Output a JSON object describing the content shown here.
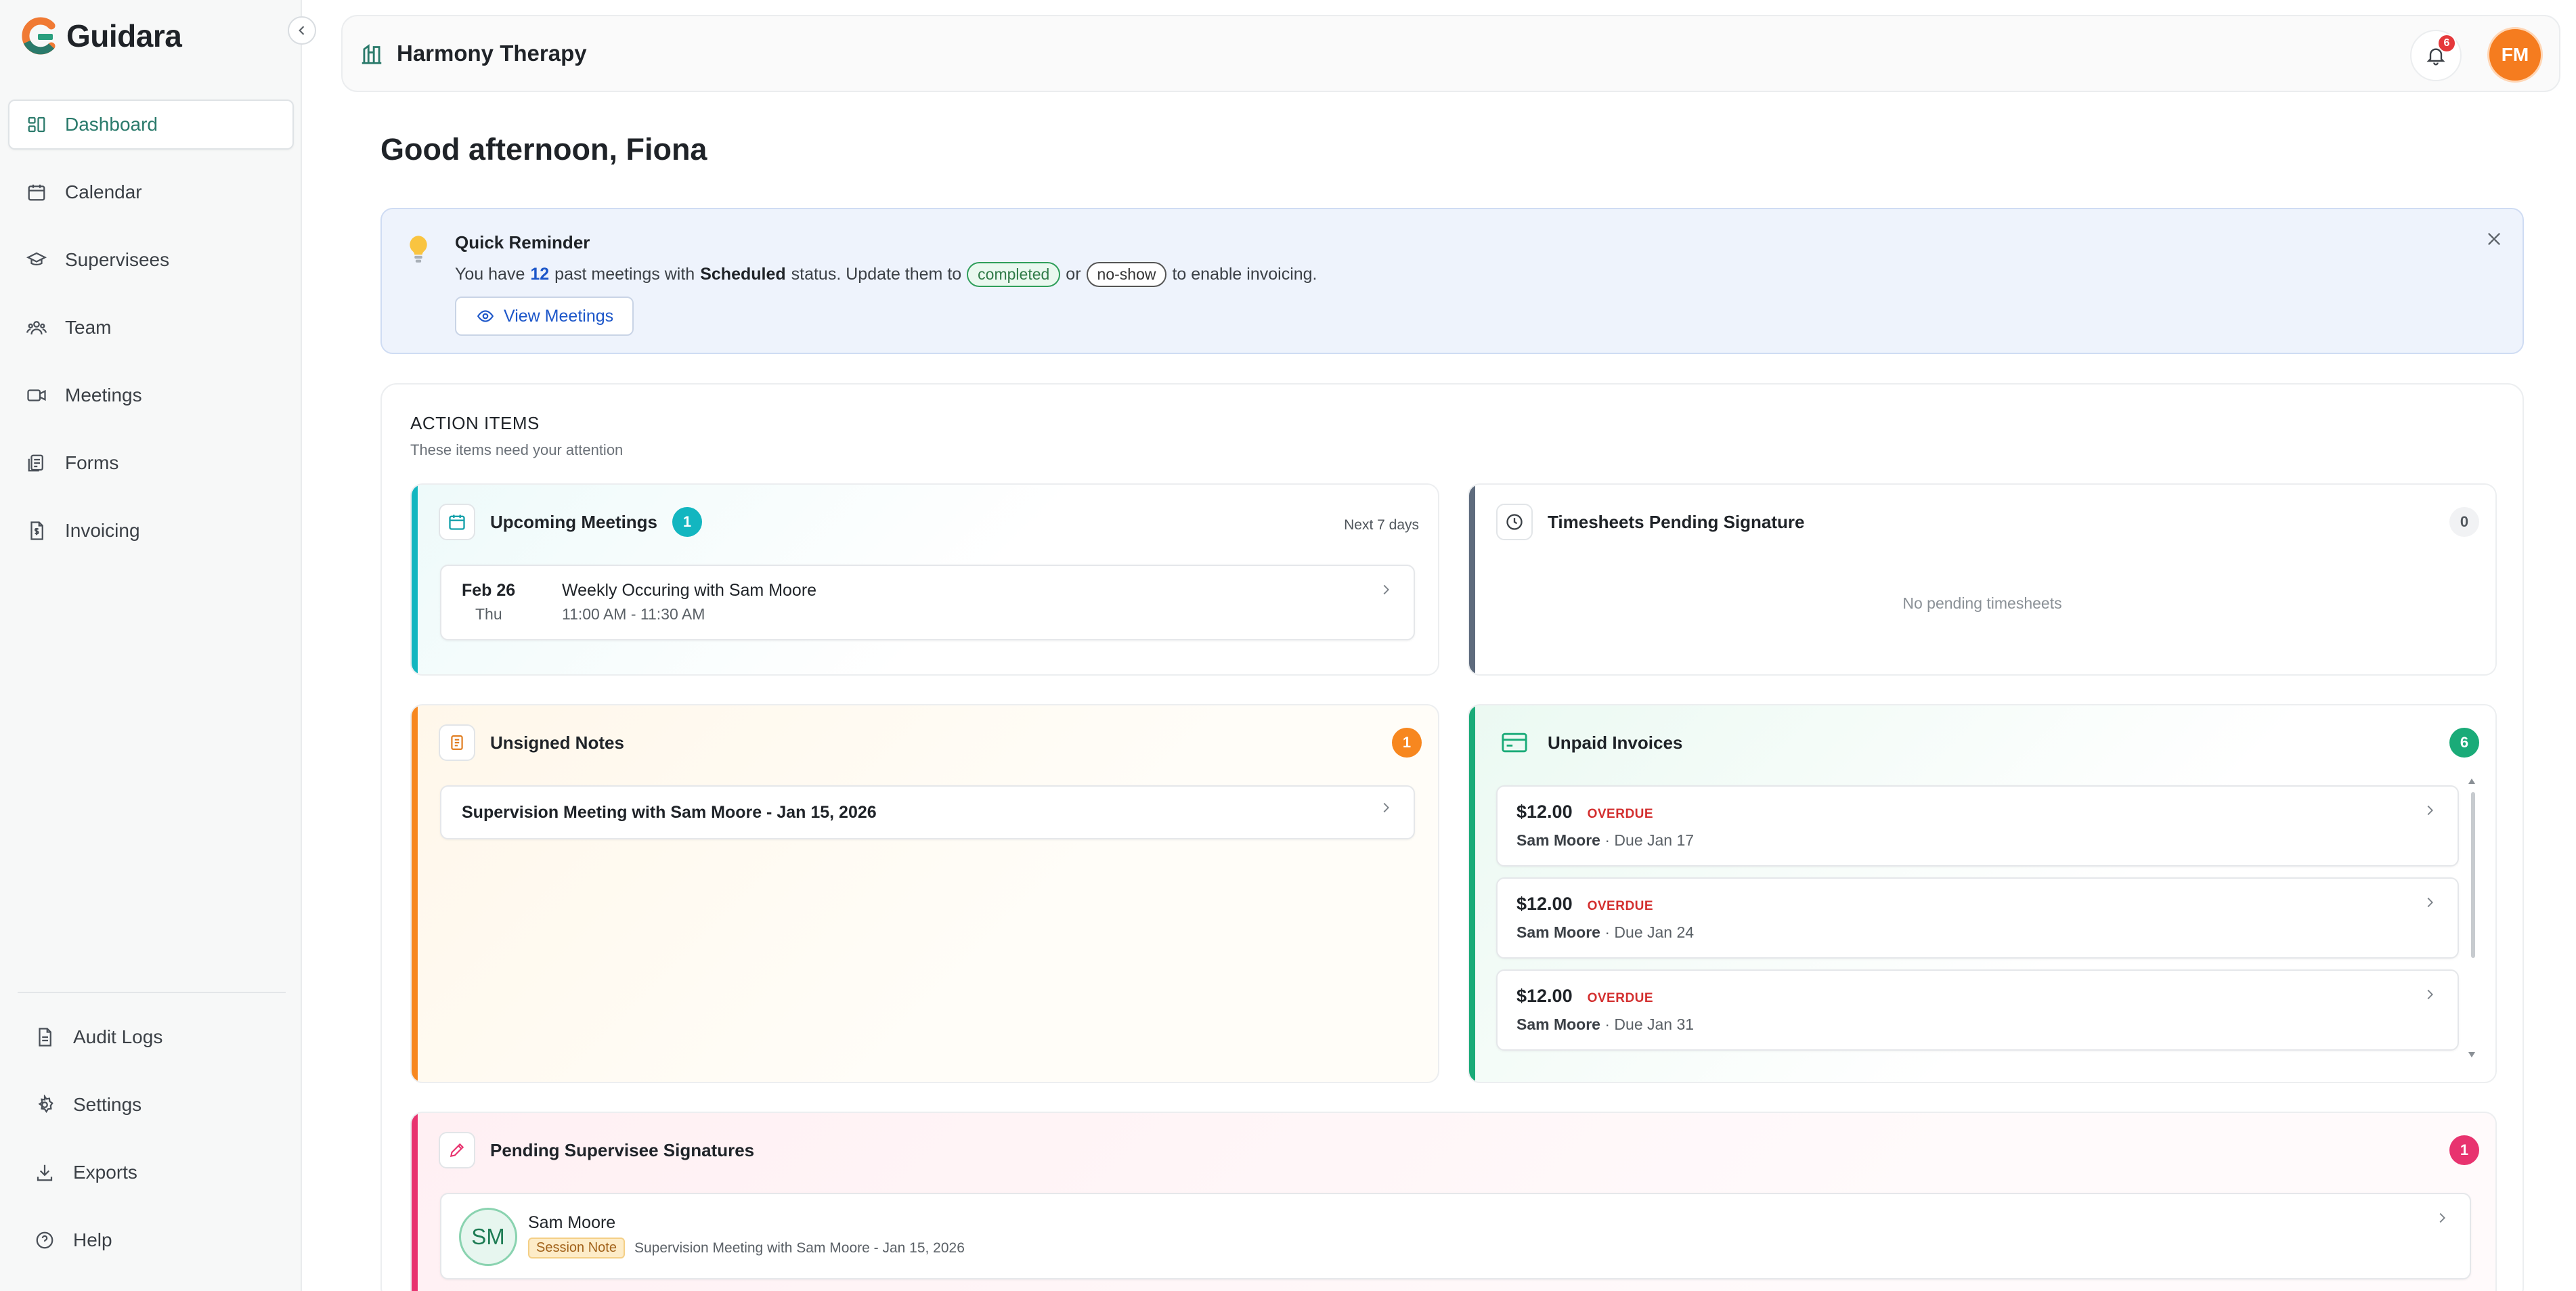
{
  "app": {
    "name": "Guidara"
  },
  "colors": {
    "accent": "#2a7a6b",
    "teal": "#13b6c0",
    "orange": "#f7871f",
    "green": "#1aab78",
    "pink": "#e8336f",
    "slate": "#5e6b7d"
  },
  "sidebar": {
    "items": [
      {
        "label": "Dashboard",
        "icon": "dashboard-icon",
        "active": true
      },
      {
        "label": "Calendar",
        "icon": "calendar-icon"
      },
      {
        "label": "Supervisees",
        "icon": "graduation-cap-icon"
      },
      {
        "label": "Team",
        "icon": "team-icon"
      },
      {
        "label": "Meetings",
        "icon": "video-icon"
      },
      {
        "label": "Forms",
        "icon": "forms-icon"
      },
      {
        "label": "Invoicing",
        "icon": "invoice-icon"
      }
    ],
    "bottom_items": [
      {
        "label": "Audit Logs",
        "icon": "audit-log-icon"
      },
      {
        "label": "Settings",
        "icon": "gear-icon"
      },
      {
        "label": "Exports",
        "icon": "download-icon"
      },
      {
        "label": "Help",
        "icon": "help-icon"
      }
    ]
  },
  "header": {
    "org_name": "Harmony Therapy",
    "notification_count": "6",
    "user_initials": "FM"
  },
  "greeting": "Good afternoon, Fiona",
  "reminder": {
    "title": "Quick Reminder",
    "text_1": "You have",
    "count": "12",
    "text_2": "past meetings with",
    "status": "Scheduled",
    "text_3": "status. Update them to",
    "pill_completed": "completed",
    "text_or": "or",
    "pill_noshow": "no-show",
    "text_4": "to enable invoicing.",
    "button": "View Meetings"
  },
  "action_items": {
    "title": "ACTION ITEMS",
    "subtitle": "These items need your attention",
    "upcoming": {
      "title": "Upcoming Meetings",
      "count": "1",
      "range": "Next 7 days",
      "items": [
        {
          "date": "Feb 26",
          "day": "Thu",
          "title": "Weekly Occuring with Sam Moore",
          "time": "11:00 AM - 11:30 AM"
        }
      ]
    },
    "timesheets": {
      "title": "Timesheets Pending Signature",
      "count": "0",
      "empty": "No pending timesheets"
    },
    "unsigned": {
      "title": "Unsigned Notes",
      "count": "1",
      "items": [
        {
          "label": "Supervision Meeting with Sam Moore - Jan 15, 2026"
        }
      ]
    },
    "invoices": {
      "title": "Unpaid Invoices",
      "count": "6",
      "items": [
        {
          "amount": "$12.00",
          "status": "OVERDUE",
          "name": "Sam Moore",
          "due": "· Due Jan 17"
        },
        {
          "amount": "$12.00",
          "status": "OVERDUE",
          "name": "Sam Moore",
          "due": "· Due Jan 24"
        },
        {
          "amount": "$12.00",
          "status": "OVERDUE",
          "name": "Sam Moore",
          "due": "· Due Jan 31"
        }
      ]
    },
    "signatures": {
      "title": "Pending Supervisee Signatures",
      "count": "1",
      "items": [
        {
          "initials": "SM",
          "name": "Sam Moore",
          "tag": "Session Note",
          "detail": "Supervision Meeting with Sam Moore - Jan 15, 2026"
        }
      ]
    }
  }
}
